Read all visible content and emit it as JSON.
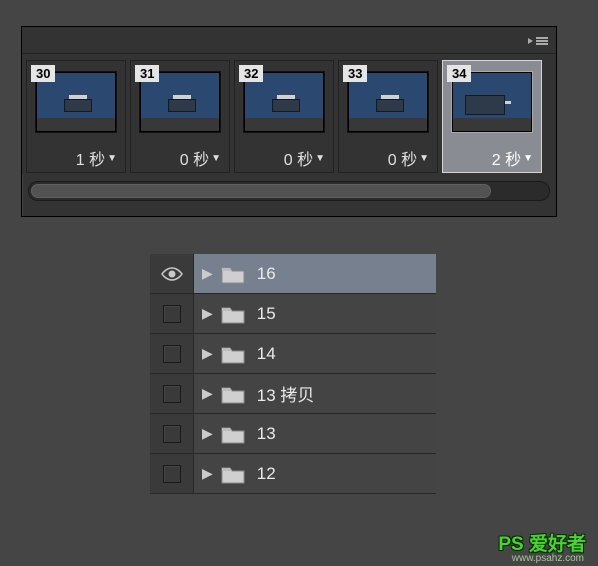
{
  "timeline": {
    "frames": [
      {
        "number": "30",
        "duration": "1 秒",
        "selected": false
      },
      {
        "number": "31",
        "duration": "0 秒",
        "selected": false
      },
      {
        "number": "32",
        "duration": "0 秒",
        "selected": false
      },
      {
        "number": "33",
        "duration": "0 秒",
        "selected": false
      },
      {
        "number": "34",
        "duration": "2 秒",
        "selected": true
      }
    ]
  },
  "layers": {
    "items": [
      {
        "name": "16",
        "visible": true,
        "selected": true
      },
      {
        "name": "15",
        "visible": false,
        "selected": false
      },
      {
        "name": "14",
        "visible": false,
        "selected": false
      },
      {
        "name": "13 拷贝",
        "visible": false,
        "selected": false
      },
      {
        "name": "13",
        "visible": false,
        "selected": false
      },
      {
        "name": "12",
        "visible": false,
        "selected": false
      }
    ]
  },
  "watermark": {
    "brand": "PS 爱好者",
    "url": "www.psahz.com"
  }
}
